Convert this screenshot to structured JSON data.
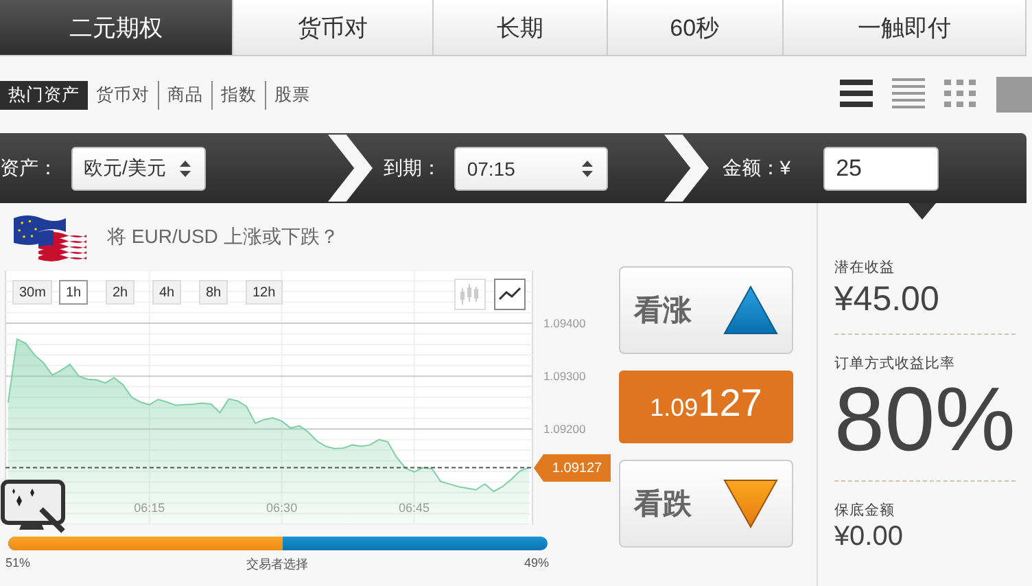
{
  "tabs": [
    {
      "label": "二元期权",
      "selected": true
    },
    {
      "label": "货币对",
      "selected": false
    },
    {
      "label": "长期",
      "selected": false
    },
    {
      "label": "60秒",
      "selected": false
    },
    {
      "label": "一触即付",
      "selected": false
    }
  ],
  "categories": [
    {
      "label": "热门资产",
      "selected": true
    },
    {
      "label": "货币对",
      "selected": false
    },
    {
      "label": "商品",
      "selected": false
    },
    {
      "label": "指数",
      "selected": false
    },
    {
      "label": "股票",
      "selected": false
    }
  ],
  "view_modes": [
    {
      "kind": "list",
      "selected": true
    },
    {
      "kind": "compact",
      "selected": false
    },
    {
      "kind": "grid",
      "selected": false
    },
    {
      "kind": "tile",
      "selected": false
    }
  ],
  "order_bar": {
    "asset_label": "资产：",
    "asset_value": "欧元/美元",
    "expiry_label": "到期：",
    "expiry_value": "07:15",
    "amount_label": "金额：¥",
    "amount_value": "25"
  },
  "question": "将 EUR/USD 上涨或下跌？",
  "timeframes": [
    {
      "label": "30m",
      "selected": false
    },
    {
      "label": "1h",
      "selected": true
    },
    {
      "label": "2h",
      "selected": false
    },
    {
      "label": "4h",
      "selected": false
    },
    {
      "label": "8h",
      "selected": false
    },
    {
      "label": "12h",
      "selected": false
    }
  ],
  "chart_types": [
    {
      "kind": "candles",
      "selected": false
    },
    {
      "kind": "line",
      "selected": true
    }
  ],
  "chart": {
    "current_price_tag": "1.09127",
    "chart_data": {
      "type": "area",
      "categories": [
        null,
        null,
        null,
        null,
        null,
        null,
        null,
        null,
        null,
        null,
        null,
        null,
        null,
        null,
        null,
        null,
        "06:15",
        null,
        null,
        null,
        null,
        null,
        null,
        null,
        null,
        null,
        null,
        null,
        null,
        null,
        null,
        "06:30",
        null,
        null,
        null,
        null,
        null,
        null,
        null,
        null,
        null,
        null,
        null,
        null,
        null,
        null,
        "06:45",
        null,
        null,
        null,
        null,
        null,
        null,
        null,
        null,
        null,
        null,
        null,
        null,
        null
      ],
      "series": [
        {
          "color": "#7fcfa6",
          "values": [
            1.0925,
            1.0937,
            1.09362,
            1.0934,
            1.09325,
            1.09302,
            1.09311,
            1.09322,
            1.093,
            1.09294,
            1.09293,
            1.09287,
            1.09297,
            1.09284,
            1.0926,
            1.09251,
            1.09246,
            1.09256,
            1.09251,
            1.09245,
            1.09246,
            1.09247,
            1.09249,
            1.09247,
            1.09231,
            1.09257,
            1.09253,
            1.09243,
            1.09211,
            1.09218,
            1.09221,
            1.09215,
            1.09202,
            1.09206,
            1.09194,
            1.09177,
            1.09167,
            1.09163,
            1.09164,
            1.0917,
            1.09167,
            1.0917,
            1.0918,
            1.09176,
            1.09147,
            1.09126,
            1.09119,
            1.09127,
            1.09125,
            1.09101,
            1.09096,
            1.09091,
            1.09088,
            1.09085,
            1.09096,
            1.09082,
            1.09091,
            1.09105,
            1.09121,
            1.09127
          ]
        }
      ],
      "ylim": [
        1.0902,
        1.095
      ],
      "grid": true,
      "ref_lines": [
        {
          "axis": "y",
          "value": 1.09127
        }
      ],
      "yticks": [
        {
          "value": 1.094,
          "label": "1.09400"
        },
        {
          "value": 1.093,
          "label": "1.09300"
        },
        {
          "value": 1.092,
          "label": "1.09200"
        }
      ]
    }
  },
  "sentiment": {
    "level": 0.51,
    "up_percent": "51%",
    "caption": "交易者选择",
    "down_percent": "49%"
  },
  "call_button": "看涨",
  "current_price": {
    "prefix": "1.09",
    "suffix": "127"
  },
  "put_button": "看跌",
  "payout": {
    "potential_label": "潜在收益",
    "potential_value": "¥45.00",
    "rate_label": "订单方式收益比率",
    "rate_value": "80%",
    "floor_label": "保底金额",
    "floor_value": "¥0.00"
  }
}
